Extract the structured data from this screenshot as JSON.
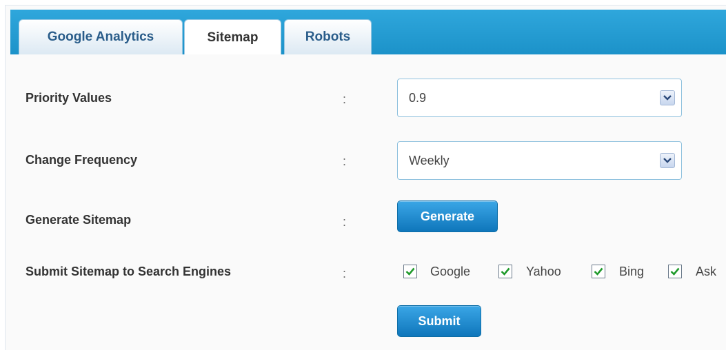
{
  "tabs": [
    {
      "label": "Google Analytics",
      "active": false
    },
    {
      "label": "Sitemap",
      "active": true
    },
    {
      "label": "Robots",
      "active": false
    }
  ],
  "form": {
    "priority": {
      "label": "Priority Values",
      "colon": ":",
      "value": "0.9"
    },
    "frequency": {
      "label": "Change Frequency",
      "colon": ":",
      "value": "Weekly"
    },
    "generate": {
      "label": "Generate Sitemap",
      "colon": ":",
      "button": "Generate"
    },
    "submit_engines": {
      "label": "Submit Sitemap to Search Engines",
      "colon": ":",
      "engines": [
        {
          "label": "Google",
          "checked": true
        },
        {
          "label": "Yahoo",
          "checked": true
        },
        {
          "label": "Bing",
          "checked": true
        },
        {
          "label": "Ask",
          "checked": true
        }
      ]
    },
    "submit_button": "Submit"
  },
  "colors": {
    "tabbar": "#1c92c9",
    "button": "#0f76bb",
    "checkmark": "#1f9a2b"
  }
}
